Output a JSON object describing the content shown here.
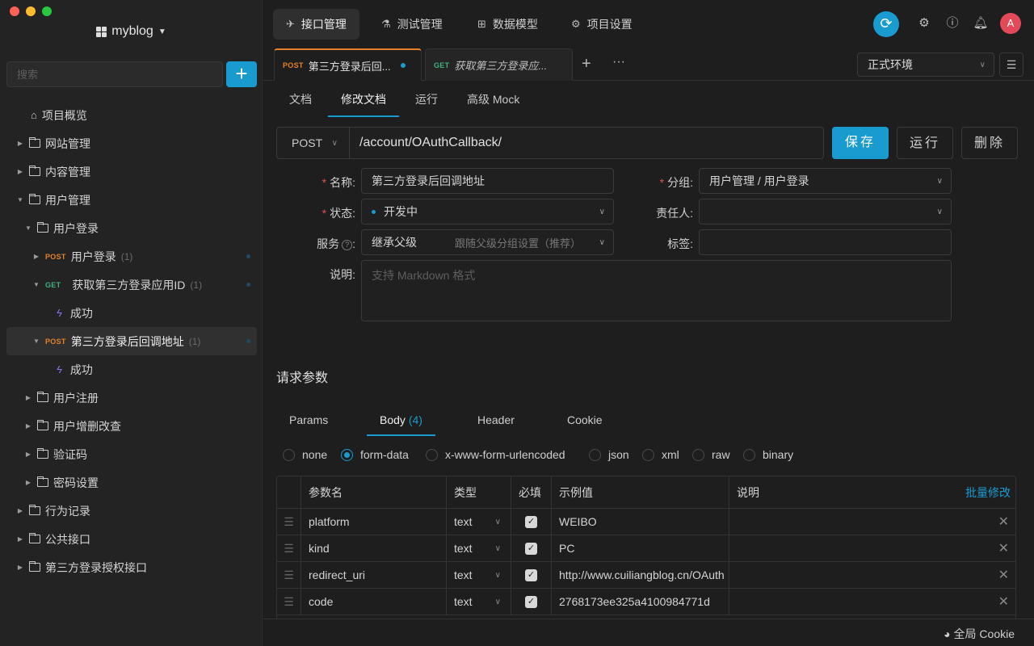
{
  "colors": {
    "accent": "#1a9bd0",
    "post": "#e5812b",
    "get": "#3fb27f",
    "required": "#e0524f",
    "bolt": "#8b74e8"
  },
  "sidebar": {
    "project_name": "myblog",
    "search_placeholder": "搜索",
    "add_label": "+",
    "items": [
      {
        "label": "项目概览"
      },
      {
        "label": "网站管理"
      },
      {
        "label": "内容管理"
      },
      {
        "label": "用户管理"
      },
      {
        "label": "用户登录"
      },
      {
        "method": "POST",
        "label": "用户登录",
        "count": "(1)"
      },
      {
        "method": "GET",
        "label": "获取第三方登录应用ID",
        "count": "(1)"
      },
      {
        "label": "成功"
      },
      {
        "method": "POST",
        "label": "第三方登录后回调地址",
        "count": "(1)"
      },
      {
        "label": "成功"
      },
      {
        "label": "用户注册"
      },
      {
        "label": "用户增删改查"
      },
      {
        "label": "验证码"
      },
      {
        "label": "密码设置"
      },
      {
        "label": "行为记录"
      },
      {
        "label": "公共接口"
      },
      {
        "label": "第三方登录授权接口"
      }
    ]
  },
  "topnav": [
    {
      "label": "接口管理",
      "icon": "rocket-icon"
    },
    {
      "label": "测试管理",
      "icon": "flask-icon"
    },
    {
      "label": "数据模型",
      "icon": "model-icon"
    },
    {
      "label": "项目设置",
      "icon": "gear-icon"
    }
  ],
  "avatar_text": "A",
  "tabs": [
    {
      "method": "POST",
      "label": "第三方登录后回..."
    },
    {
      "method": "GET",
      "label": "获取第三方登录应..."
    }
  ],
  "environment": "正式环境",
  "subtabs": [
    "文档",
    "修改文档",
    "运行",
    "高级 Mock"
  ],
  "request": {
    "method": "POST",
    "path": "/account/OAuthCallback/"
  },
  "buttons": {
    "save": "保存",
    "run": "运行",
    "delete": "删除"
  },
  "form": {
    "name_label": "名称:",
    "name_value": "第三方登录后回调地址",
    "group_label": "分组:",
    "group_value": "用户管理 / 用户登录",
    "status_label": "状态:",
    "status_value": "开发中",
    "owner_label": "责任人:",
    "service_label": "服务",
    "service_value": "继承父级",
    "service_hint": "跟随父级分组设置（推荐）",
    "tag_label": "标签:",
    "desc_label": "说明:",
    "desc_placeholder": "支持 Markdown 格式"
  },
  "params_section": {
    "title": "请求参数",
    "tabs": [
      {
        "label": "Params"
      },
      {
        "label": "Body",
        "count": "(4)"
      },
      {
        "label": "Header"
      },
      {
        "label": "Cookie"
      }
    ],
    "body_types": [
      "none",
      "form-data",
      "x-www-form-urlencoded",
      "json",
      "xml",
      "raw",
      "binary"
    ],
    "selected_body_type": "form-data",
    "columns": [
      "参数名",
      "类型",
      "必填",
      "示例值",
      "说明"
    ],
    "bulk_edit": "批量修改",
    "rows": [
      {
        "name": "platform",
        "type": "text",
        "required": true,
        "example": "WEIBO"
      },
      {
        "name": "kind",
        "type": "text",
        "required": true,
        "example": "PC"
      },
      {
        "name": "redirect_uri",
        "type": "text",
        "required": true,
        "example": "http://www.cuiliangblog.cn/OAuth"
      },
      {
        "name": "code",
        "type": "text",
        "required": true,
        "example": "2768173ee325a4100984771d"
      }
    ]
  },
  "footer": {
    "cookie_label": "全局 Cookie"
  }
}
